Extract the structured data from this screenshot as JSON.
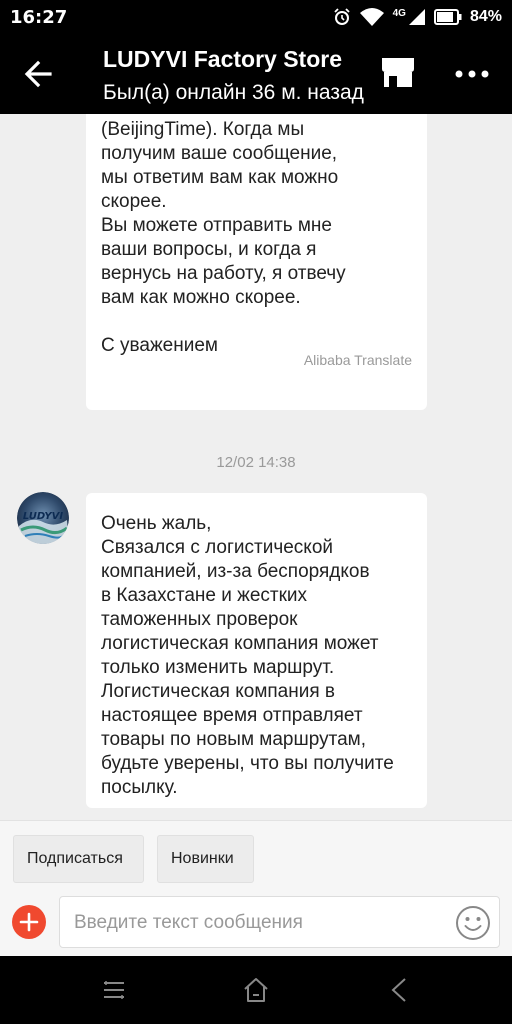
{
  "status_bar": {
    "time": "16:27",
    "network": "4G",
    "battery": "84%"
  },
  "header": {
    "title": "LUDYVI Factory Store",
    "subtitle": "Был(а) онлайн 36 м. назад",
    "icons": [
      "back-arrow-icon",
      "store-icon",
      "more-icon"
    ]
  },
  "messages": [
    {
      "text": "(BeijingTime). Когда мы\nполучим ваше сообщение,\nмы ответим вам как можно\nскорее.\nВы можете отправить мне\nваши вопросы, и когда я\nвернусь на работу, я отвечу\nвам как можно скорее.\n\nС уважением",
      "translation_label": "Alibaba Translate"
    },
    {
      "timestamp": "12/02 14:38",
      "avatar_text": "LUDYVI",
      "text": "Очень жаль,\nСвязался с логистической\nкомпанией, из-за беспорядков\nв Казахстане и жестких\nтаможенных проверок\nлогистическая компания может\nтолько изменить маршрут.\nЛогистическая компания в\nнастоящее время отправляет\nтовары по новым маршрутам,\nбудьте уверены, что вы получите\nпосылку."
    }
  ],
  "quick_actions": [
    "Подписаться",
    "Новинки"
  ],
  "composer": {
    "placeholder": "Введите текст сообщения",
    "value": ""
  },
  "colors": {
    "header_bg": "#000000",
    "chat_bg": "#efefef",
    "bubble_bg": "#ffffff",
    "accent_plus": "#f0492f"
  }
}
